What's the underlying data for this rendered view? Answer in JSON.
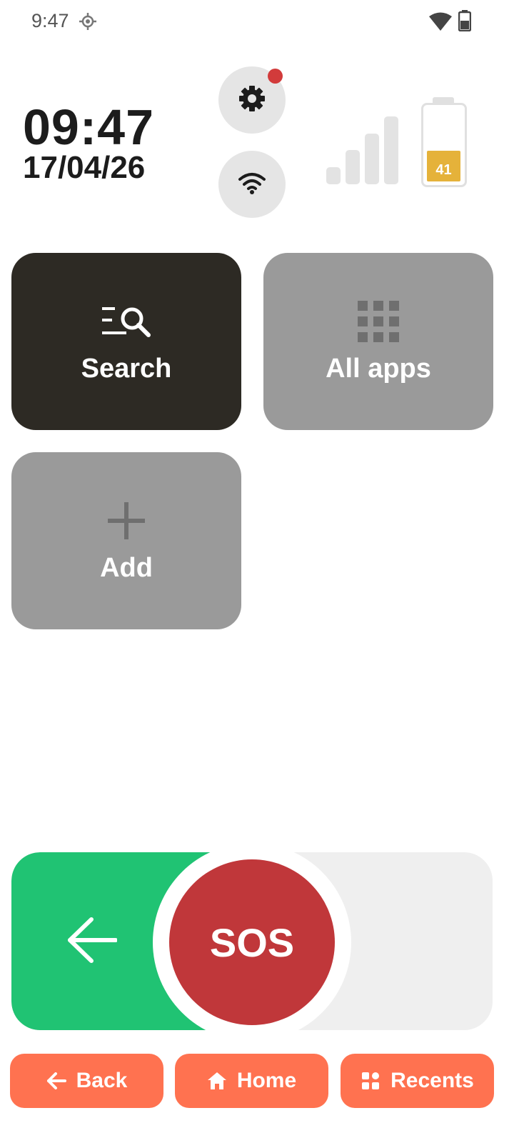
{
  "status_bar": {
    "time": "9:47",
    "icons": [
      "location-icon",
      "wifi-icon",
      "battery-icon"
    ]
  },
  "clock": {
    "time": "09:47",
    "date": "17/04/26"
  },
  "quick_actions": {
    "settings_icon": "gear-icon",
    "wifi_icon": "wifi-icon",
    "notification_dot_color": "#d23b3b"
  },
  "signal": {
    "bars": 4
  },
  "battery": {
    "level": "41",
    "fill_color": "#e5b23a"
  },
  "tiles": [
    {
      "label": "Search",
      "icon": "search-list-icon"
    },
    {
      "label": "All apps",
      "icon": "grid-icon"
    },
    {
      "label": "Add",
      "icon": "plus-icon"
    }
  ],
  "sos": {
    "label": "SOS",
    "track_accent": "#20c373",
    "button_color": "#c0373a"
  },
  "nav": {
    "back": "Back",
    "home": "Home",
    "recents": "Recents",
    "color": "#ff7250"
  }
}
